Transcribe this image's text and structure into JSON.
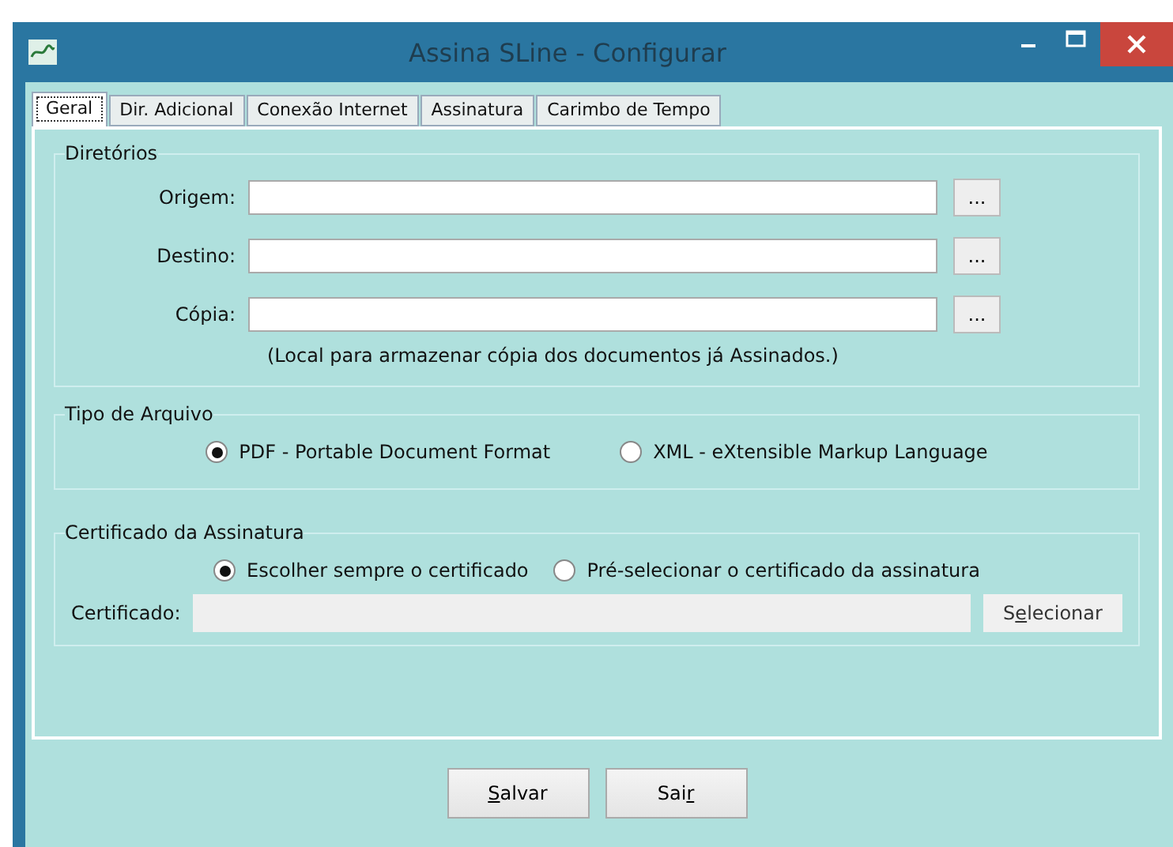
{
  "window": {
    "title": "Assina SLine - Configurar"
  },
  "tabs": [
    {
      "label": "Geral",
      "selected": true
    },
    {
      "label": "Dir. Adicional",
      "selected": false
    },
    {
      "label": "Conexão Internet",
      "selected": false
    },
    {
      "label": "Assinatura",
      "selected": false
    },
    {
      "label": "Carimbo de Tempo",
      "selected": false
    }
  ],
  "directories": {
    "title": "Diretórios",
    "fields": [
      {
        "label": "Origem:",
        "button": "..."
      },
      {
        "label": "Destino:",
        "button": "..."
      },
      {
        "label": "Cópia:",
        "button": "..."
      }
    ],
    "note": "(Local para armazenar cópia dos documentos já Assinados.)"
  },
  "file_type": {
    "title": "Tipo de Arquivo",
    "options": [
      {
        "label": "PDF - Portable Document Format",
        "selected": true
      },
      {
        "label": "XML - eXtensible Markup Language",
        "selected": false
      }
    ]
  },
  "certificate": {
    "title": "Certificado da Assinatura",
    "options": [
      {
        "label": "Escolher sempre o certificado",
        "selected": true
      },
      {
        "label": "Pré-selecionar o certificado da assinatura",
        "selected": false
      }
    ],
    "field_label": "Certificado:",
    "field_disabled": true,
    "button": {
      "pre": "S",
      "key": "e",
      "post": "lecionar"
    }
  },
  "buttons": [
    {
      "key": "S",
      "post": "alvar"
    },
    {
      "pre": "Sai",
      "key": "r"
    }
  ]
}
